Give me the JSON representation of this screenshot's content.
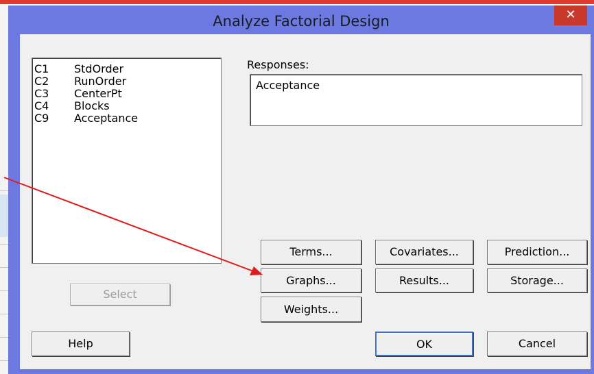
{
  "window": {
    "title": "Analyze Factorial Design",
    "close_glyph": "✕"
  },
  "variables": [
    {
      "id": "C1",
      "name": "StdOrder"
    },
    {
      "id": "C2",
      "name": "RunOrder"
    },
    {
      "id": "C3",
      "name": "CenterPt"
    },
    {
      "id": "C4",
      "name": "Blocks"
    },
    {
      "id": "C9",
      "name": "Acceptance"
    }
  ],
  "select_label": "Select",
  "responses": {
    "label": "Responses:",
    "value": "Acceptance"
  },
  "option_buttons": {
    "terms": "Terms...",
    "covariates": "Covariates...",
    "prediction": "Prediction...",
    "graphs": "Graphs...",
    "results": "Results...",
    "storage": "Storage...",
    "weights": "Weights..."
  },
  "footer": {
    "help": "Help",
    "ok": "OK",
    "cancel": "Cancel"
  },
  "colors": {
    "frame": "#6b79e0",
    "close": "#c8392b",
    "annotation_arrow": "#e01b1b"
  }
}
